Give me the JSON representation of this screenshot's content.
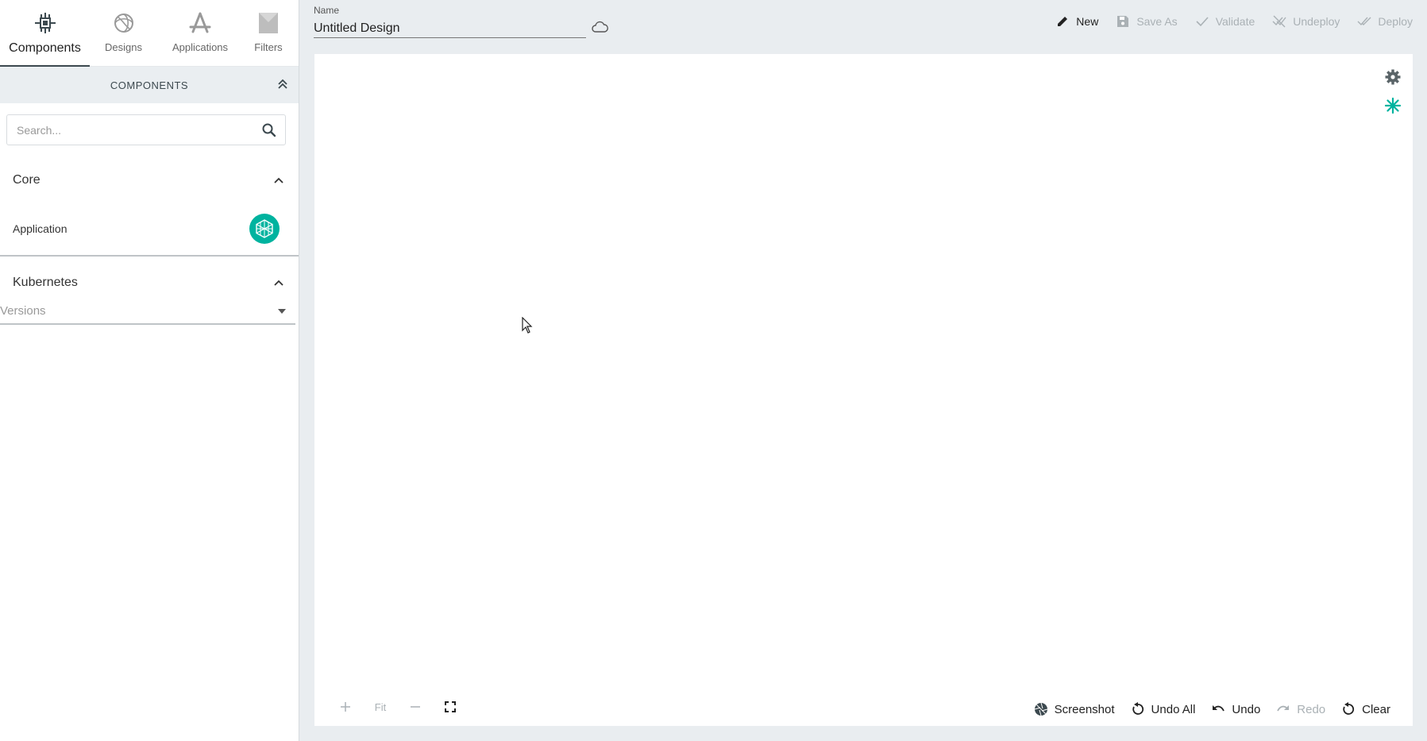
{
  "sidebar": {
    "tabs": [
      {
        "label": "Components",
        "icon": "components-icon",
        "active": true
      },
      {
        "label": "Designs",
        "icon": "designs-icon",
        "active": false
      },
      {
        "label": "Applications",
        "icon": "applications-icon",
        "active": false
      },
      {
        "label": "Filters",
        "icon": "filters-icon",
        "active": false
      }
    ],
    "section_title": "COMPONENTS",
    "search": {
      "placeholder": "Search...",
      "value": ""
    },
    "groups": [
      {
        "title": "Core",
        "items": [
          {
            "label": "Application"
          }
        ]
      },
      {
        "title": "Kubernetes",
        "versions_placeholder": "Versions"
      }
    ]
  },
  "topbar": {
    "name_label": "Name",
    "name_value": "Untitled Design",
    "actions": [
      {
        "label": "New",
        "enabled": true
      },
      {
        "label": "Save As",
        "enabled": false
      },
      {
        "label": "Validate",
        "enabled": false
      },
      {
        "label": "Undeploy",
        "enabled": false
      },
      {
        "label": "Deploy",
        "enabled": false
      }
    ]
  },
  "canvas": {
    "zoom": {
      "fit_label": "Fit"
    },
    "bottom_actions": [
      {
        "label": "Screenshot",
        "enabled": true
      },
      {
        "label": "Undo All",
        "enabled": true
      },
      {
        "label": "Undo",
        "enabled": true
      },
      {
        "label": "Redo",
        "enabled": false
      },
      {
        "label": "Clear",
        "enabled": true
      }
    ]
  },
  "colors": {
    "accent": "#00b39f",
    "dark": "#3c494f",
    "disabled": "#aab1b5"
  }
}
